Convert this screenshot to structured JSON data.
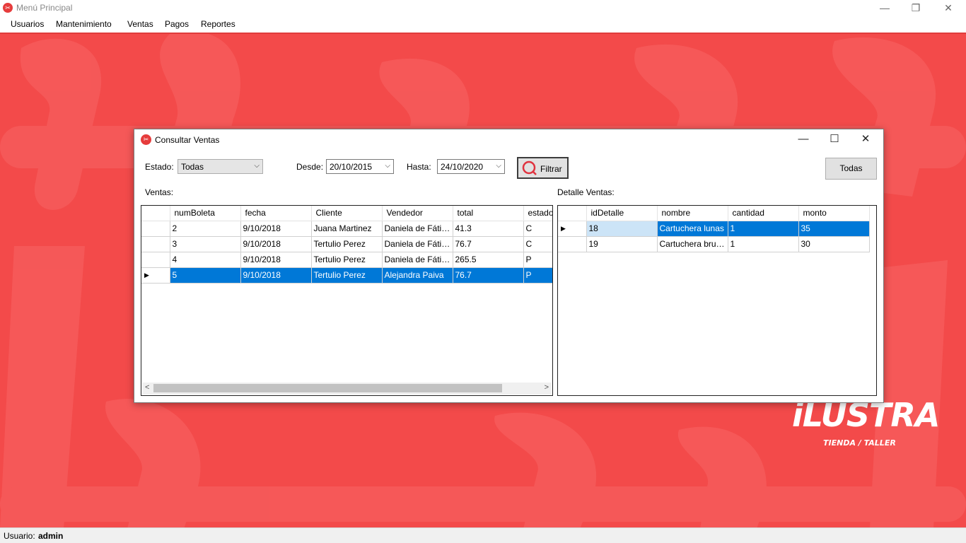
{
  "main_window": {
    "title": "Menú Principal",
    "minimize_glyph": "—",
    "restore_glyph": "❐",
    "close_glyph": "✕"
  },
  "menu": {
    "items": [
      "Usuarios",
      "Mantenimiento",
      "Ventas",
      "Pagos",
      "Reportes"
    ]
  },
  "status_bar": {
    "label": "Usuario:",
    "user": "admin"
  },
  "brand": {
    "name": "iLUSTRA",
    "tagline": "TIENDA / TALLER"
  },
  "dialog": {
    "title": "Consultar Ventas",
    "filters": {
      "estado_label": "Estado:",
      "estado_value": "Todas",
      "desde_label": "Desde:",
      "desde_value": "20/10/2015",
      "hasta_label": "Hasta:",
      "hasta_value": "24/10/2020",
      "filter_button": "Filtrar",
      "all_button": "Todas"
    },
    "ventas": {
      "label": "Ventas:",
      "columns": [
        "numBoleta",
        "fecha",
        "Cliente",
        "Vendedor",
        "total",
        "estado"
      ],
      "rows": [
        [
          "2",
          "9/10/2018",
          "Juana Martinez",
          "Daniela de Fátima",
          "41.3",
          "C"
        ],
        [
          "3",
          "9/10/2018",
          "Tertulio Perez",
          "Daniela de Fátima",
          "76.7",
          "C"
        ],
        [
          "4",
          "9/10/2018",
          "Tertulio Perez",
          "Daniela de Fátima",
          "265.5",
          "P"
        ],
        [
          "5",
          "9/10/2018",
          "Tertulio Perez",
          "Alejandra Paiva",
          "76.7",
          "P"
        ]
      ],
      "selected_row": 3
    },
    "detalle": {
      "label": "Detalle Ventas:",
      "columns": [
        "idDetalle",
        "nombre",
        "cantidad",
        "monto"
      ],
      "rows": [
        [
          "18",
          "Cartuchera lunas",
          "1",
          "35"
        ],
        [
          "19",
          "Cartuchera brunje",
          "1",
          "30"
        ]
      ],
      "selected_row": 0
    }
  }
}
